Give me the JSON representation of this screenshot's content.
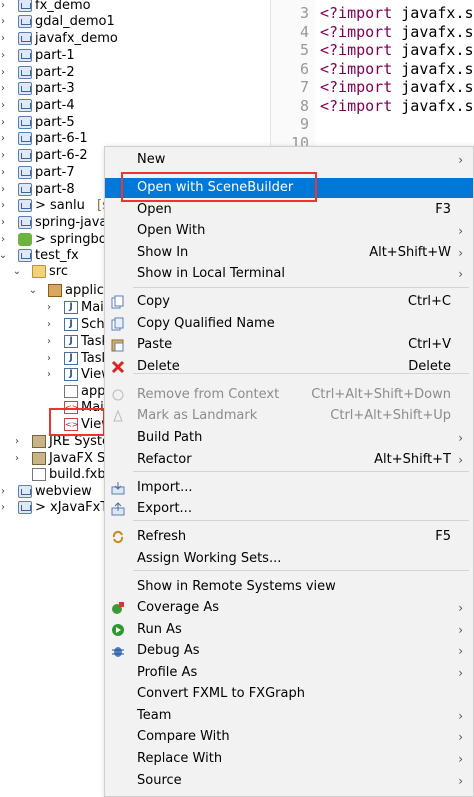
{
  "tree": {
    "items": [
      {
        "label": "fx_demo",
        "icon": "project-icon"
      },
      {
        "label": "gdal_demo1",
        "icon": "project-icon"
      },
      {
        "label": "javafx_demo",
        "icon": "project-icon"
      },
      {
        "label": "part-1",
        "icon": "project-icon"
      },
      {
        "label": "part-2",
        "icon": "project-icon"
      },
      {
        "label": "part-3",
        "icon": "project-icon"
      },
      {
        "label": "part-4",
        "icon": "project-icon"
      },
      {
        "label": "part-5",
        "icon": "project-icon"
      },
      {
        "label": "part-6-1",
        "icon": "project-icon"
      },
      {
        "label": "part-6-2",
        "icon": "project-icon"
      },
      {
        "label": "part-7",
        "icon": "project-icon"
      },
      {
        "label": "part-8",
        "icon": "project-icon"
      },
      {
        "label": "> sanlu",
        "suffix": "[san",
        "icon": "project-icon"
      },
      {
        "label": "spring-javafx",
        "icon": "project-icon"
      },
      {
        "label": "> springboo",
        "icon": "spring-icon"
      },
      {
        "label": "test_fx",
        "icon": "project-icon"
      },
      {
        "label": "src",
        "icon": "folder-icon"
      },
      {
        "label": "applica",
        "icon": "package-icon"
      },
      {
        "label": "Mai",
        "icon": "java-file-icon"
      },
      {
        "label": "Sche",
        "icon": "java-file-icon"
      },
      {
        "label": "Task",
        "icon": "java-file-icon"
      },
      {
        "label": "Task",
        "icon": "java-file-icon"
      },
      {
        "label": "View",
        "icon": "java-file-icon"
      },
      {
        "label": "app",
        "icon": "file-icon"
      },
      {
        "label": "Mai",
        "icon": "fxml-file-icon"
      },
      {
        "label": "View",
        "icon": "fxml-file-icon"
      },
      {
        "label": "JRE Syste",
        "icon": "library-icon"
      },
      {
        "label": "JavaFX SD",
        "icon": "library-icon"
      },
      {
        "label": "build.fxbu",
        "icon": "file-icon"
      },
      {
        "label": "webview",
        "icon": "project-icon"
      },
      {
        "label": "> xJavaFxTo",
        "icon": "project-icon"
      }
    ]
  },
  "editor": {
    "lines": [
      {
        "num": "3",
        "kw": "<?import",
        "code": " javafx.sc"
      },
      {
        "num": "4",
        "kw": "<?import",
        "code": " javafx.sc"
      },
      {
        "num": "5",
        "kw": "<?import",
        "code": " javafx.sc"
      },
      {
        "num": "6",
        "kw": "<?import",
        "code": " javafx.sc"
      },
      {
        "num": "7",
        "kw": "<?import",
        "code": " javafx.sc"
      },
      {
        "num": "8",
        "kw": "<?import",
        "code": " javafx.sc"
      },
      {
        "num": "9",
        "kw": "",
        "code": ""
      },
      {
        "num": "10",
        "kw": "",
        "code": ""
      }
    ]
  },
  "menu": {
    "items": [
      {
        "label": "New",
        "shortcut": "",
        "submenu": true
      },
      {
        "label": "Open with SceneBuilder",
        "shortcut": "",
        "highlighted": true
      },
      {
        "label": "Open",
        "shortcut": "F3"
      },
      {
        "label": "Open With",
        "shortcut": "",
        "submenu": true
      },
      {
        "label": "Show In",
        "shortcut": "Alt+Shift+W",
        "submenu": true
      },
      {
        "label": "Show in Local Terminal",
        "shortcut": "",
        "submenu": true
      },
      {
        "label": "Copy",
        "shortcut": "Ctrl+C",
        "icon": "copy-icon"
      },
      {
        "label": "Copy Qualified Name",
        "shortcut": "",
        "icon": "copy-qualified-icon"
      },
      {
        "label": "Paste",
        "shortcut": "Ctrl+V",
        "icon": "paste-icon"
      },
      {
        "label": "Delete",
        "shortcut": "Delete",
        "icon": "delete-icon"
      },
      {
        "label": "Remove from Context",
        "shortcut": "Ctrl+Alt+Shift+Down",
        "disabled": true,
        "icon": "remove-context-icon"
      },
      {
        "label": "Mark as Landmark",
        "shortcut": "Ctrl+Alt+Shift+Up",
        "disabled": true,
        "icon": "landmark-icon"
      },
      {
        "label": "Build Path",
        "shortcut": "",
        "submenu": true
      },
      {
        "label": "Refactor",
        "shortcut": "Alt+Shift+T",
        "submenu": true
      },
      {
        "label": "Import...",
        "shortcut": "",
        "icon": "import-icon"
      },
      {
        "label": "Export...",
        "shortcut": "",
        "icon": "export-icon"
      },
      {
        "label": "Refresh",
        "shortcut": "F5",
        "icon": "refresh-icon"
      },
      {
        "label": "Assign Working Sets...",
        "shortcut": ""
      },
      {
        "label": "Show in Remote Systems view",
        "shortcut": ""
      },
      {
        "label": "Coverage As",
        "shortcut": "",
        "submenu": true,
        "icon": "coverage-icon"
      },
      {
        "label": "Run As",
        "shortcut": "",
        "submenu": true,
        "icon": "run-icon"
      },
      {
        "label": "Debug As",
        "shortcut": "",
        "submenu": true,
        "icon": "debug-icon"
      },
      {
        "label": "Profile As",
        "shortcut": "",
        "submenu": true
      },
      {
        "label": "Convert FXML to FXGraph",
        "shortcut": ""
      },
      {
        "label": "Team",
        "shortcut": "",
        "submenu": true
      },
      {
        "label": "Compare With",
        "shortcut": "",
        "submenu": true
      },
      {
        "label": "Replace With",
        "shortcut": "",
        "submenu": true
      },
      {
        "label": "Source",
        "shortcut": "",
        "submenu": true
      }
    ],
    "submenu_glyph": "›"
  },
  "colors": {
    "highlight": "#0078d7",
    "annotation": "#e33333"
  }
}
